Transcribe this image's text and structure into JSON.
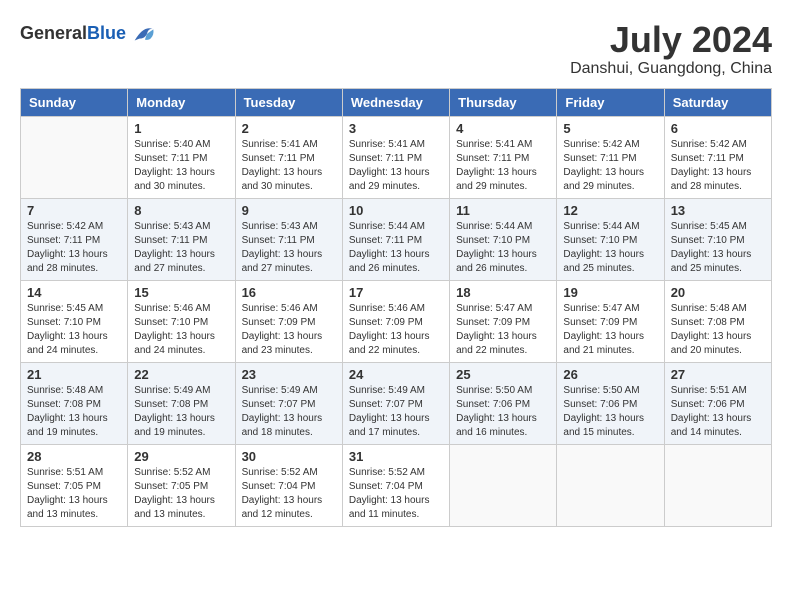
{
  "header": {
    "logo_general": "General",
    "logo_blue": "Blue",
    "month_year": "July 2024",
    "location": "Danshui, Guangdong, China"
  },
  "weekdays": [
    "Sunday",
    "Monday",
    "Tuesday",
    "Wednesday",
    "Thursday",
    "Friday",
    "Saturday"
  ],
  "weeks": [
    [
      {
        "day": "",
        "sunrise": "",
        "sunset": "",
        "daylight": ""
      },
      {
        "day": "1",
        "sunrise": "Sunrise: 5:40 AM",
        "sunset": "Sunset: 7:11 PM",
        "daylight": "Daylight: 13 hours and 30 minutes."
      },
      {
        "day": "2",
        "sunrise": "Sunrise: 5:41 AM",
        "sunset": "Sunset: 7:11 PM",
        "daylight": "Daylight: 13 hours and 30 minutes."
      },
      {
        "day": "3",
        "sunrise": "Sunrise: 5:41 AM",
        "sunset": "Sunset: 7:11 PM",
        "daylight": "Daylight: 13 hours and 29 minutes."
      },
      {
        "day": "4",
        "sunrise": "Sunrise: 5:41 AM",
        "sunset": "Sunset: 7:11 PM",
        "daylight": "Daylight: 13 hours and 29 minutes."
      },
      {
        "day": "5",
        "sunrise": "Sunrise: 5:42 AM",
        "sunset": "Sunset: 7:11 PM",
        "daylight": "Daylight: 13 hours and 29 minutes."
      },
      {
        "day": "6",
        "sunrise": "Sunrise: 5:42 AM",
        "sunset": "Sunset: 7:11 PM",
        "daylight": "Daylight: 13 hours and 28 minutes."
      }
    ],
    [
      {
        "day": "7",
        "sunrise": "Sunrise: 5:42 AM",
        "sunset": "Sunset: 7:11 PM",
        "daylight": "Daylight: 13 hours and 28 minutes."
      },
      {
        "day": "8",
        "sunrise": "Sunrise: 5:43 AM",
        "sunset": "Sunset: 7:11 PM",
        "daylight": "Daylight: 13 hours and 27 minutes."
      },
      {
        "day": "9",
        "sunrise": "Sunrise: 5:43 AM",
        "sunset": "Sunset: 7:11 PM",
        "daylight": "Daylight: 13 hours and 27 minutes."
      },
      {
        "day": "10",
        "sunrise": "Sunrise: 5:44 AM",
        "sunset": "Sunset: 7:11 PM",
        "daylight": "Daylight: 13 hours and 26 minutes."
      },
      {
        "day": "11",
        "sunrise": "Sunrise: 5:44 AM",
        "sunset": "Sunset: 7:10 PM",
        "daylight": "Daylight: 13 hours and 26 minutes."
      },
      {
        "day": "12",
        "sunrise": "Sunrise: 5:44 AM",
        "sunset": "Sunset: 7:10 PM",
        "daylight": "Daylight: 13 hours and 25 minutes."
      },
      {
        "day": "13",
        "sunrise": "Sunrise: 5:45 AM",
        "sunset": "Sunset: 7:10 PM",
        "daylight": "Daylight: 13 hours and 25 minutes."
      }
    ],
    [
      {
        "day": "14",
        "sunrise": "Sunrise: 5:45 AM",
        "sunset": "Sunset: 7:10 PM",
        "daylight": "Daylight: 13 hours and 24 minutes."
      },
      {
        "day": "15",
        "sunrise": "Sunrise: 5:46 AM",
        "sunset": "Sunset: 7:10 PM",
        "daylight": "Daylight: 13 hours and 24 minutes."
      },
      {
        "day": "16",
        "sunrise": "Sunrise: 5:46 AM",
        "sunset": "Sunset: 7:09 PM",
        "daylight": "Daylight: 13 hours and 23 minutes."
      },
      {
        "day": "17",
        "sunrise": "Sunrise: 5:46 AM",
        "sunset": "Sunset: 7:09 PM",
        "daylight": "Daylight: 13 hours and 22 minutes."
      },
      {
        "day": "18",
        "sunrise": "Sunrise: 5:47 AM",
        "sunset": "Sunset: 7:09 PM",
        "daylight": "Daylight: 13 hours and 22 minutes."
      },
      {
        "day": "19",
        "sunrise": "Sunrise: 5:47 AM",
        "sunset": "Sunset: 7:09 PM",
        "daylight": "Daylight: 13 hours and 21 minutes."
      },
      {
        "day": "20",
        "sunrise": "Sunrise: 5:48 AM",
        "sunset": "Sunset: 7:08 PM",
        "daylight": "Daylight: 13 hours and 20 minutes."
      }
    ],
    [
      {
        "day": "21",
        "sunrise": "Sunrise: 5:48 AM",
        "sunset": "Sunset: 7:08 PM",
        "daylight": "Daylight: 13 hours and 19 minutes."
      },
      {
        "day": "22",
        "sunrise": "Sunrise: 5:49 AM",
        "sunset": "Sunset: 7:08 PM",
        "daylight": "Daylight: 13 hours and 19 minutes."
      },
      {
        "day": "23",
        "sunrise": "Sunrise: 5:49 AM",
        "sunset": "Sunset: 7:07 PM",
        "daylight": "Daylight: 13 hours and 18 minutes."
      },
      {
        "day": "24",
        "sunrise": "Sunrise: 5:49 AM",
        "sunset": "Sunset: 7:07 PM",
        "daylight": "Daylight: 13 hours and 17 minutes."
      },
      {
        "day": "25",
        "sunrise": "Sunrise: 5:50 AM",
        "sunset": "Sunset: 7:06 PM",
        "daylight": "Daylight: 13 hours and 16 minutes."
      },
      {
        "day": "26",
        "sunrise": "Sunrise: 5:50 AM",
        "sunset": "Sunset: 7:06 PM",
        "daylight": "Daylight: 13 hours and 15 minutes."
      },
      {
        "day": "27",
        "sunrise": "Sunrise: 5:51 AM",
        "sunset": "Sunset: 7:06 PM",
        "daylight": "Daylight: 13 hours and 14 minutes."
      }
    ],
    [
      {
        "day": "28",
        "sunrise": "Sunrise: 5:51 AM",
        "sunset": "Sunset: 7:05 PM",
        "daylight": "Daylight: 13 hours and 13 minutes."
      },
      {
        "day": "29",
        "sunrise": "Sunrise: 5:52 AM",
        "sunset": "Sunset: 7:05 PM",
        "daylight": "Daylight: 13 hours and 13 minutes."
      },
      {
        "day": "30",
        "sunrise": "Sunrise: 5:52 AM",
        "sunset": "Sunset: 7:04 PM",
        "daylight": "Daylight: 13 hours and 12 minutes."
      },
      {
        "day": "31",
        "sunrise": "Sunrise: 5:52 AM",
        "sunset": "Sunset: 7:04 PM",
        "daylight": "Daylight: 13 hours and 11 minutes."
      },
      {
        "day": "",
        "sunrise": "",
        "sunset": "",
        "daylight": ""
      },
      {
        "day": "",
        "sunrise": "",
        "sunset": "",
        "daylight": ""
      },
      {
        "day": "",
        "sunrise": "",
        "sunset": "",
        "daylight": ""
      }
    ]
  ]
}
